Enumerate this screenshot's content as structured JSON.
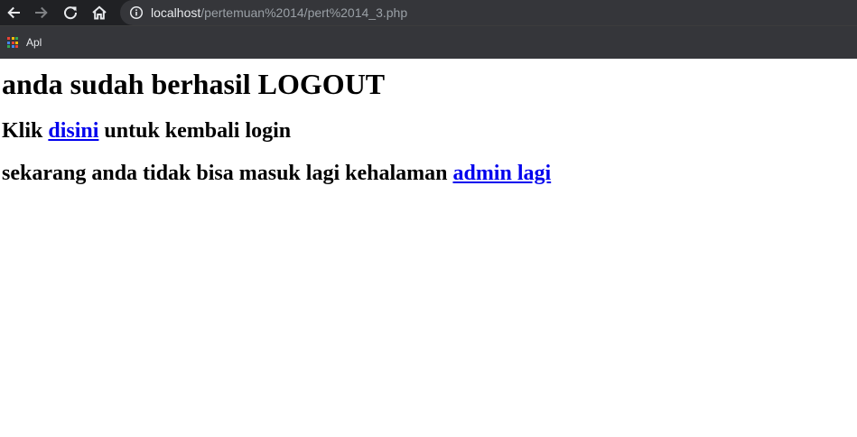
{
  "browser": {
    "url_host": "localhost",
    "url_path": "/pertemuan%2014/pert%2014_3.php",
    "bookmarks": {
      "apps_label": "Apl"
    },
    "colors": {
      "toolbar_bg": "#202124",
      "omnibox_bg": "#35363a",
      "apps_grid": [
        "#ea4335",
        "#fbbc04",
        "#34a853",
        "#4285f4",
        "#ea4335",
        "#fbbc04",
        "#34a853",
        "#4285f4",
        "#ea4335"
      ]
    }
  },
  "page": {
    "heading": "anda sudah berhasil LOGOUT",
    "line1": {
      "prefix": "Klik ",
      "link": "disini",
      "suffix": " untuk kembali login"
    },
    "line2": {
      "prefix": "sekarang anda tidak bisa masuk lagi kehalaman ",
      "link": "admin lagi"
    },
    "link_color": "#0000ee"
  }
}
